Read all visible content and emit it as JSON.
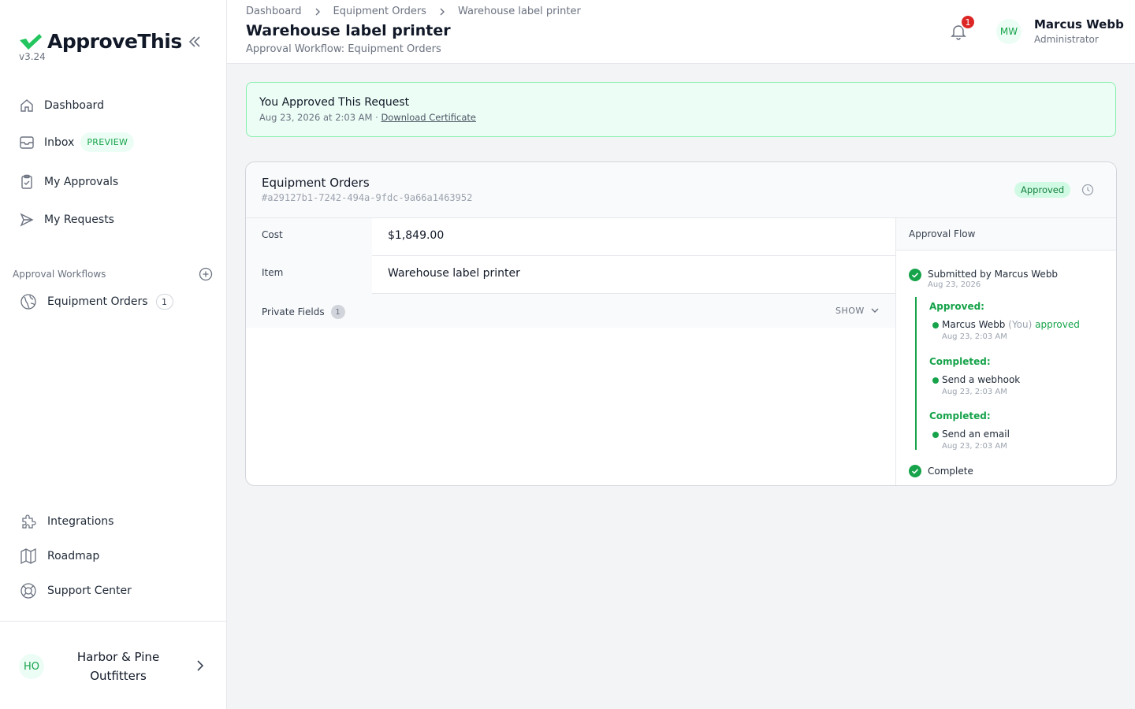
{
  "app": {
    "name": "ApproveThis",
    "version": "v3.24"
  },
  "sidebar": {
    "nav": [
      {
        "label": "Dashboard",
        "icon": "home-icon"
      },
      {
        "label": "Inbox",
        "icon": "inbox-icon",
        "badge": "PREVIEW"
      },
      {
        "label": "My Approvals",
        "icon": "clipboard-check-icon"
      },
      {
        "label": "My Requests",
        "icon": "send-icon"
      }
    ],
    "section_label": "Approval Workflows",
    "workflows": [
      {
        "label": "Equipment Orders",
        "count": "1",
        "icon": "globe-icon"
      }
    ],
    "bottom_nav": [
      {
        "label": "Integrations",
        "icon": "puzzle-icon"
      },
      {
        "label": "Roadmap",
        "icon": "map-icon"
      },
      {
        "label": "Support Center",
        "icon": "lifebuoy-icon"
      }
    ],
    "org": {
      "initials": "HO",
      "name": "Harbor & Pine Outfitters"
    }
  },
  "header": {
    "breadcrumb": [
      "Dashboard",
      "Equipment Orders",
      "Warehouse label printer"
    ],
    "title": "Warehouse label printer",
    "subtitle": "Approval Workflow: Equipment Orders",
    "notifications": "1",
    "user": {
      "initials": "MW",
      "name": "Marcus Webb",
      "role": "Administrator"
    }
  },
  "banner": {
    "title": "You Approved This Request",
    "timestamp": "Aug 23, 2026 at 2:03 AM",
    "separator": "·",
    "link": "Download Certificate"
  },
  "request": {
    "workflow": "Equipment Orders",
    "id": "#a29127b1-7242-494a-9fdc-9a66a1463952",
    "status": "Approved",
    "fields": [
      {
        "label": "Cost",
        "value": "$1,849.00"
      },
      {
        "label": "Item",
        "value": "Warehouse label printer"
      }
    ],
    "private_fields": {
      "label": "Private Fields",
      "count": "1",
      "toggle": "SHOW"
    }
  },
  "flow": {
    "title": "Approval Flow",
    "submitted": {
      "text": "Submitted by Marcus Webb",
      "date": "Aug 23, 2026"
    },
    "groups": [
      {
        "label": "Approved:",
        "item": "Marcus Webb",
        "you": "(You)",
        "action": "approved",
        "date": "Aug 23, 2:03 AM"
      },
      {
        "label": "Completed:",
        "item": "Send a webhook",
        "date": "Aug 23, 2:03 AM"
      },
      {
        "label": "Completed:",
        "item": "Send an email",
        "date": "Aug 23, 2:03 AM"
      }
    ],
    "complete": "Complete"
  },
  "colors": {
    "accent": "#16a34a",
    "banner_bg": "#ecfdf5",
    "badge_red": "#dc2626"
  }
}
